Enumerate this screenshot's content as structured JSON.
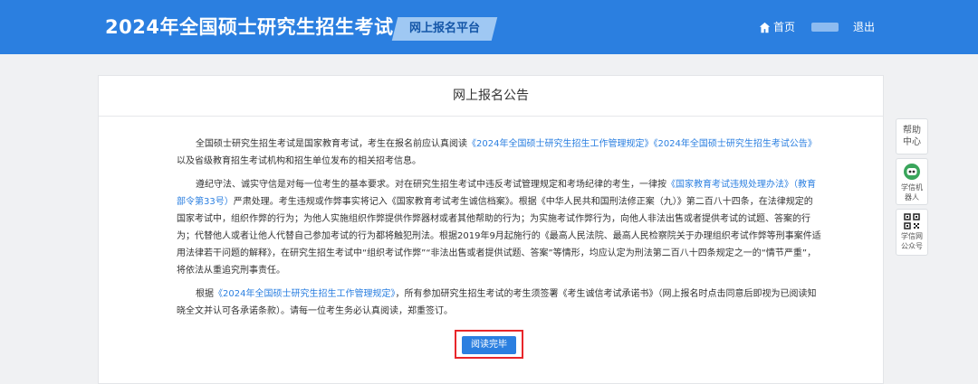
{
  "header": {
    "site_title": "2024年全国硕士研究生招生考试",
    "platform_badge": "网上报名平台",
    "nav_home": "首页",
    "nav_logout": "退出"
  },
  "notice": {
    "title": "网上报名公告",
    "p1": {
      "t1": "全国硕士研究生招生考试是国家教育考试，考生在报名前应认真阅读",
      "link1": "《2024年全国硕士研究生招生工作管理规定》",
      "link2": "《2024年全国硕士研究生招生考试公告》",
      "t2": "以及省级教育招生考试机构和招生单位发布的相关招考信息。"
    },
    "p2": {
      "t1": "遵纪守法、诚实守信是对每一位考生的基本要求。对在研究生招生考试中违反考试管理规定和考场纪律的考生，一律按",
      "link1": "《国家教育考试违规处理办法》（教育部令第33号）",
      "t2": "严肃处理。考生违规或作弊事实将记入《国家教育考试考生诚信档案》。根据《中华人民共和国刑法修正案（九）》第二百八十四条，在法律规定的国家考试中，组织作弊的行为；为他人实施组织作弊提供作弊器材或者其他帮助的行为；为实施考试作弊行为，向他人非法出售或者提供考试的试题、答案的行为；代替他人或者让他人代替自己参加考试的行为都将触犯刑法。根据2019年9月起施行的《最高人民法院、最高人民检察院关于办理组织考试作弊等刑事案件适用法律若干问题的解释》，在研究生招生考试中“组织考试作弊”“非法出售或者提供试题、答案”等情形，均应认定为刑法第二百八十四条规定之一的“情节严重”，将依法从重追究刑事责任。"
    },
    "p3": {
      "t1": "根据",
      "link1": "《2024年全国硕士研究生招生工作管理规定》",
      "t2": "，所有参加研究生招生考试的考生须签署《考生诚信考试承诺书》（网上报名时点击同意后即视为已阅读知晓全文并认可各承诺条款）。请每一位考生务必认真阅读，郑重签订。"
    },
    "read_button": "阅读完毕"
  },
  "side_tools": {
    "help": "帮助中心",
    "robot": "学信机器人",
    "qr": "学信网公众号"
  },
  "colors": {
    "header_bg": "#2b7fe0",
    "link": "#2b7fe0",
    "highlight_border": "#e8262a"
  },
  "icons": [
    "home-icon",
    "robot-icon",
    "qr-code-icon"
  ]
}
